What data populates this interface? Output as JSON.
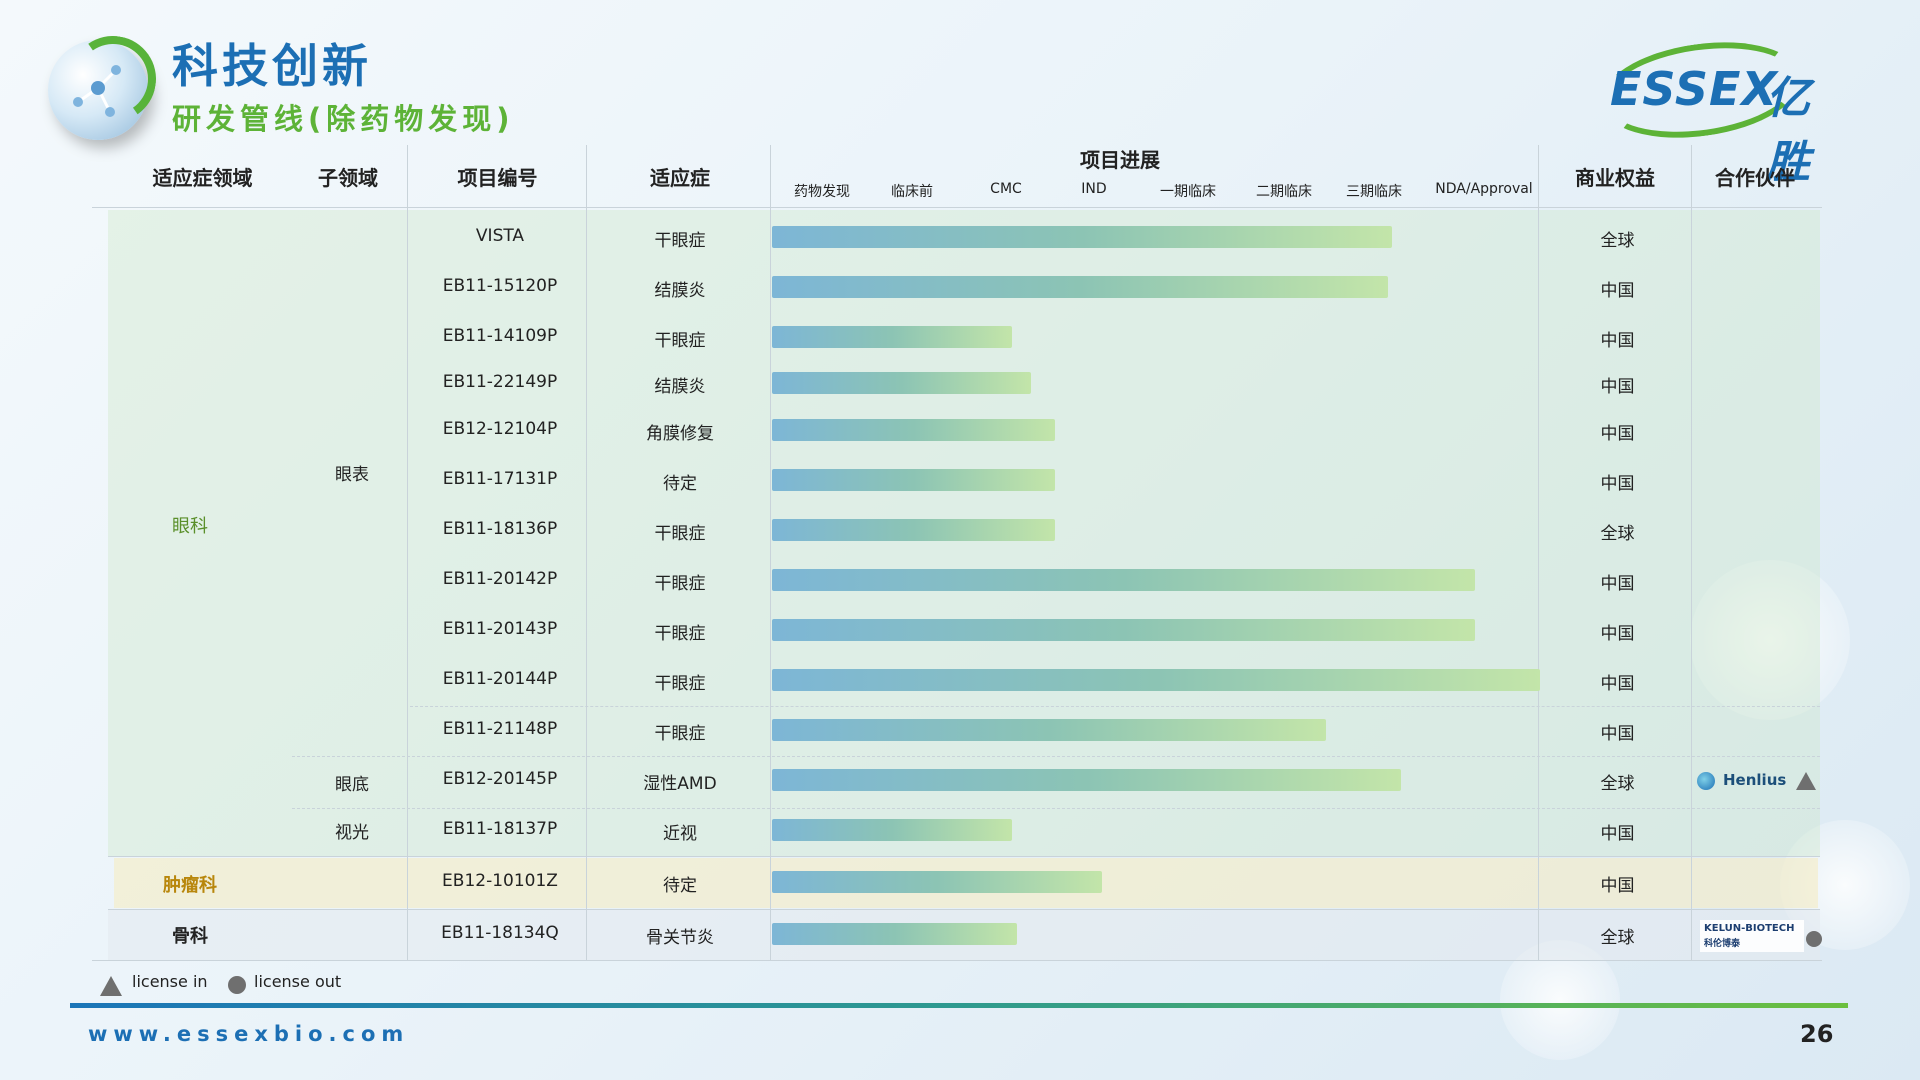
{
  "header": {
    "title": "科技创新",
    "subtitle": "研发管线(除药物发现)",
    "brand_latin": "ESSEX",
    "brand_cn": "亿胜"
  },
  "table": {
    "columns": {
      "area": "适应症领域",
      "subarea": "子领域",
      "code": "项目编号",
      "indication": "适应症",
      "progress": "项目进展",
      "rights": "商业权益",
      "partner": "合作伙伴"
    },
    "stages": [
      "药物发现",
      "临床前",
      "CMC",
      "IND",
      "一期临床",
      "二期临床",
      "三期临床",
      "NDA/Approval"
    ],
    "areas": {
      "ophthalmology": "眼科",
      "oncology": "肿瘤科",
      "orthopedics": "骨科"
    },
    "subareas": {
      "ocular_surface": "眼表",
      "fundus": "眼底",
      "vision": "视光"
    },
    "rows": [
      {
        "code": "VISTA",
        "indication": "干眼症",
        "rights": "全球",
        "progress": 0.807
      },
      {
        "code": "EB11-15120P",
        "indication": "结膜炎",
        "rights": "中国",
        "progress": 0.802
      },
      {
        "code": "EB11-14109P",
        "indication": "干眼症",
        "rights": "中国",
        "progress": 0.312
      },
      {
        "code": "EB11-22149P",
        "indication": "结膜炎",
        "rights": "中国",
        "progress": 0.337
      },
      {
        "code": "EB12-12104P",
        "indication": "角膜修复",
        "rights": "中国",
        "progress": 0.368
      },
      {
        "code": "EB11-17131P",
        "indication": "待定",
        "rights": "中国",
        "progress": 0.368
      },
      {
        "code": "EB11-18136P",
        "indication": "干眼症",
        "rights": "全球",
        "progress": 0.368
      },
      {
        "code": "EB11-20142P",
        "indication": "干眼症",
        "rights": "中国",
        "progress": 0.915
      },
      {
        "code": "EB11-20143P",
        "indication": "干眼症",
        "rights": "中国",
        "progress": 0.915
      },
      {
        "code": "EB11-20144P",
        "indication": "干眼症",
        "rights": "中国",
        "progress": 1.0
      },
      {
        "code": "EB11-21148P",
        "indication": "干眼症",
        "rights": "中国",
        "progress": 0.722
      },
      {
        "code": "EB12-20145P",
        "indication": "湿性AMD",
        "rights": "全球",
        "progress": 0.819
      },
      {
        "code": "EB11-18137P",
        "indication": "近视",
        "rights": "中国",
        "progress": 0.312
      },
      {
        "code": "EB12-10101Z",
        "indication": "待定",
        "rights": "中国",
        "progress": 0.43
      },
      {
        "code": "EB11-18134Q",
        "indication": "骨关节炎",
        "rights": "全球",
        "progress": 0.319
      }
    ],
    "partners": {
      "henlius": "Henlius",
      "kelun_latin": "KELUN-BIOTECH",
      "kelun_cn": "科伦博泰"
    }
  },
  "legend": {
    "license_in": "license in",
    "license_out": "license out"
  },
  "footer": {
    "url": "www.essexbio.com",
    "page": "26"
  },
  "colors": {
    "title_blue": "#1c6fb4",
    "accent_green": "#5db337",
    "oncology_gold": "#b8860b",
    "ophthalmology_green": "#5a8f2a"
  }
}
